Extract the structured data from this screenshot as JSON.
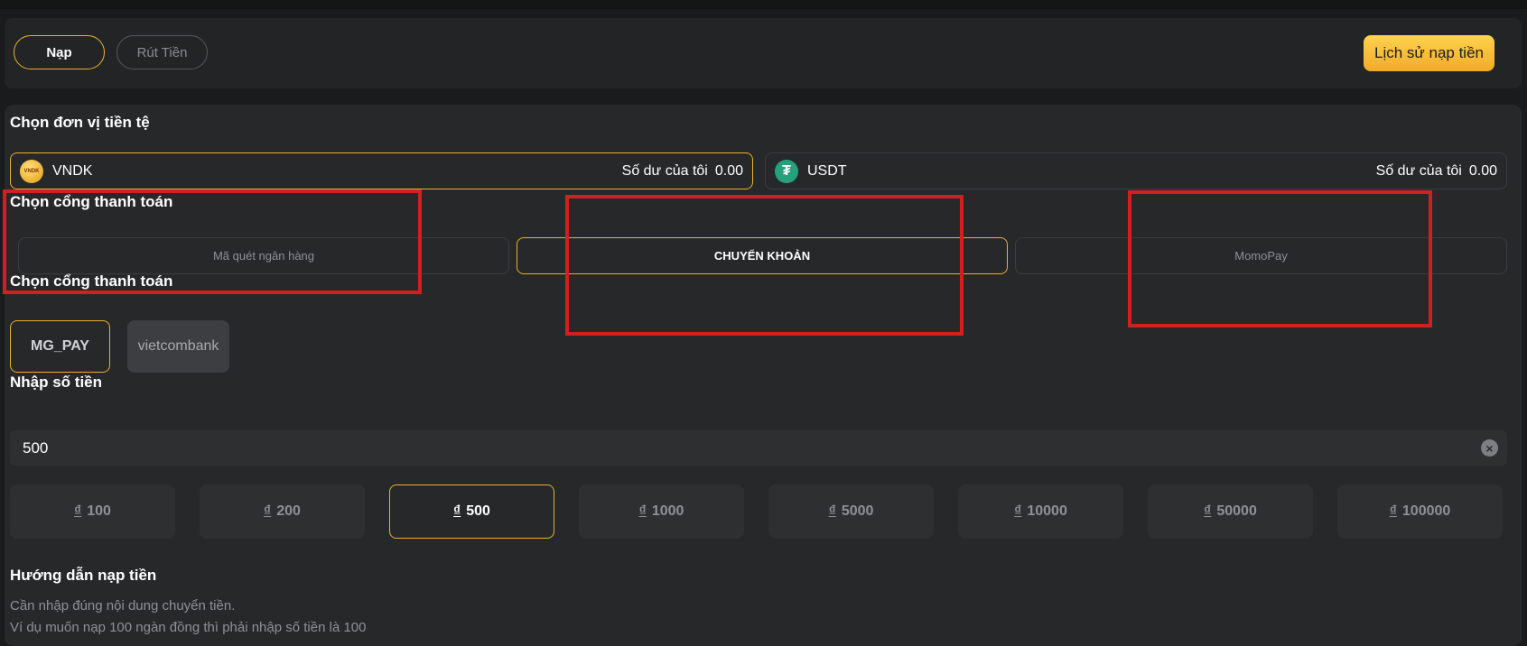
{
  "tabs": {
    "deposit": "Nạp",
    "withdraw": "Rút Tiền"
  },
  "history_button": "Lịch sử nạp tiền",
  "currency_section": {
    "title": "Chọn đơn vị tiền tệ",
    "balance_label": "Số dư của tôi",
    "items": [
      {
        "name": "VNDK",
        "balance": "0.00",
        "icon": "vndk-coin-icon",
        "selected": true
      },
      {
        "name": "USDT",
        "balance": "0.00",
        "icon": "tether-icon",
        "selected": false
      }
    ]
  },
  "gateway_section": {
    "title": "Chọn cổng thanh toán",
    "items": [
      "Mã quét ngân hàng",
      "CHUYỂN KHOẢN",
      "MomoPay"
    ],
    "selected_index": 1
  },
  "bank_section": {
    "title": "Chọn cổng thanh toán",
    "items": [
      "MG_PAY",
      "vietcombank"
    ],
    "selected_index": 0
  },
  "amount_section": {
    "title": "Nhập số tiền",
    "value": "500",
    "clear_icon": "clear-icon"
  },
  "presets": {
    "currency_symbol": "₫",
    "values": [
      "100",
      "200",
      "500",
      "1000",
      "5000",
      "10000",
      "50000",
      "100000"
    ],
    "selected_index": 2
  },
  "guide": {
    "title": "Hướng dẫn nạp tiền",
    "lines": [
      "Cần nhập đúng nội dung chuyển tiền.",
      "Ví dụ muốn nạp 100 ngàn đồng thì phải nhập số tiền là 100"
    ]
  },
  "colors": {
    "accent": "#e9b32a",
    "annotation_red": "#d0201f",
    "background": "#1a1b1c",
    "panel": "#27282a"
  }
}
